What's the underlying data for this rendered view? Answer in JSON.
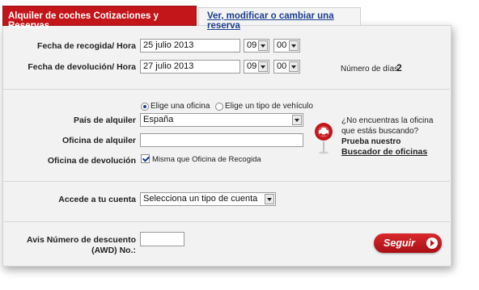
{
  "tabs": {
    "active": "Alquiler de coches Cotizaciones y Reservas",
    "inactive": "Ver, modificar o cambiar una reserva"
  },
  "pickup": {
    "label": "Fecha de recogida/ Hora",
    "date": "25 julio 2013",
    "hour": "09",
    "minute": "00"
  },
  "return": {
    "label": "Fecha de devolución/ Hora",
    "date": "27 julio 2013",
    "hour": "09",
    "minute": "00"
  },
  "days": {
    "label": "Número de días",
    "value": "2"
  },
  "search_mode": {
    "option_office": "Elige una oficina",
    "option_vehicle": "Elige un tipo de vehículo",
    "selected": "office"
  },
  "country": {
    "label": "País de alquiler",
    "value": "España"
  },
  "office": {
    "label": "Oficina de alquiler",
    "value": ""
  },
  "return_office": {
    "label": "Oficina de devolución",
    "checkbox_label": "Misma que Oficina de Recogida",
    "checked": true
  },
  "finder": {
    "question_line1": "¿No encuentras la oficina",
    "question_line2": "que estás buscando?",
    "prompt": "Prueba nuestro",
    "link": "Buscador de oficinas"
  },
  "account": {
    "label": "Accede a tu cuenta",
    "value": "Selecciona un tipo de cuenta"
  },
  "discount": {
    "label_line1": "Avis Número de descuento",
    "label_line2": "(AWD) No.:",
    "value": ""
  },
  "submit_label": "Seguir",
  "colors": {
    "brand_red": "#c3161b",
    "link_blue": "#1a3e8c",
    "panel_bg": "#f2f2f2"
  }
}
